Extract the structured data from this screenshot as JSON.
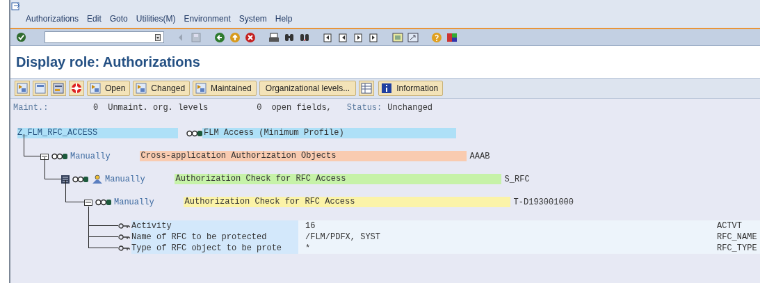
{
  "menu": [
    "Authorizations",
    "Edit",
    "Goto",
    "Utilities(M)",
    "Environment",
    "System",
    "Help"
  ],
  "title": "Display role: Authorizations",
  "app_toolbar": [
    {
      "kind": "icon"
    },
    {
      "kind": "icon"
    },
    {
      "kind": "icon"
    },
    {
      "kind": "icon"
    },
    {
      "kind": "icon_text",
      "label": "Open"
    },
    {
      "kind": "icon_text",
      "label": "Changed"
    },
    {
      "kind": "icon_text",
      "label": "Maintained"
    },
    {
      "kind": "text",
      "label": "Organizational levels..."
    },
    {
      "kind": "icon"
    },
    {
      "kind": "icon_text",
      "label": "Information"
    }
  ],
  "status_line": {
    "maint_label": "Maint.:",
    "unmaint_count": "0",
    "unmaint_text": "Unmaint. org. levels",
    "open_count": "0",
    "open_text": "open fields,",
    "status_label": "Status:",
    "status_value": "Unchanged"
  },
  "tree": {
    "name": "Z_FLM_RFC_ACCESS",
    "description": "FLM Access (Minimum Profile)",
    "color": "#aee0f7",
    "children": [
      {
        "kind": "class",
        "status": "Manually",
        "text": "Cross-application Authorization Objects",
        "code": "AAAB",
        "color": "#f9cbb0",
        "children": [
          {
            "kind": "object",
            "status": "Manually",
            "text": "Authorization Check for RFC Access",
            "code": "S_RFC",
            "color": "#c6f2a8",
            "children": [
              {
                "kind": "authorization",
                "status": "Manually",
                "text": "Authorization Check for RFC Access",
                "code": "T-D193001000",
                "color": "#fbf3a8",
                "fields": [
                  {
                    "name": "Activity",
                    "value": "16",
                    "technical": "ACTVT"
                  },
                  {
                    "name": "Name of RFC to be protected",
                    "value": "/FLM/PDFX, SYST",
                    "technical": "RFC_NAME"
                  },
                  {
                    "name": "Type of RFC object to be prote",
                    "value": "*",
                    "technical": "RFC_TYPE"
                  }
                ]
              }
            ]
          }
        ]
      }
    ]
  }
}
